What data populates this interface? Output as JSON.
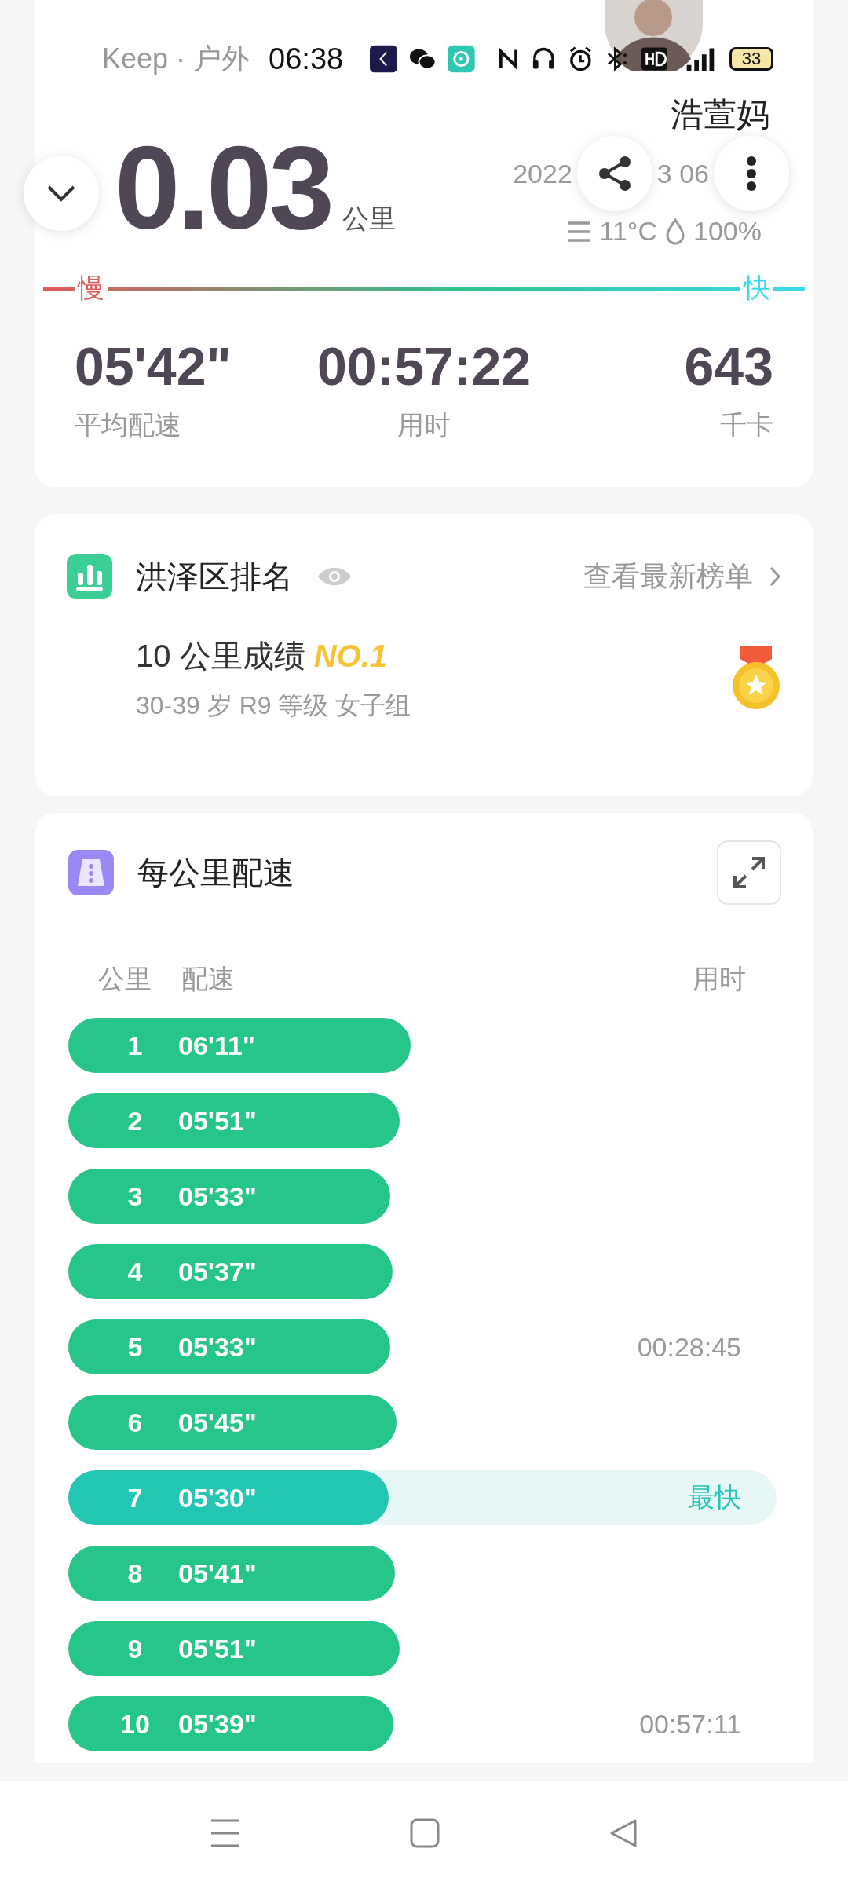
{
  "status_bar": {
    "time": "06:38",
    "battery": "33"
  },
  "header": {
    "app_title": "Keep · 户外",
    "user_name": "浩萱妈",
    "date_parts": [
      "2022",
      "3 06"
    ],
    "distance": "0.03",
    "distance_unit": "公里",
    "weather": "11°C",
    "humidity": "100%"
  },
  "pace_scale": {
    "slow_label": "慢",
    "fast_label": "快"
  },
  "stats": [
    {
      "value": "05'42\"",
      "label": "平均配速"
    },
    {
      "value": "00:57:22",
      "label": "用时"
    },
    {
      "value": "643",
      "label": "千卡"
    }
  ],
  "ranking": {
    "title": "洪泽区排名",
    "link": "查看最新榜单",
    "result": "10 公里成绩 *NO.1*",
    "subtitle": "30-39 岁 R9 等级 女子组"
  },
  "splits": {
    "title": "每公里配速",
    "columns": [
      "公里",
      "配速",
      "用时"
    ],
    "rows": [
      {
        "km": "1",
        "pace": "06'11\"",
        "fastest": false
      },
      {
        "km": "2",
        "pace": "05'51\"",
        "fastest": false
      },
      {
        "km": "3",
        "pace": "05'33\"",
        "fastest": false
      },
      {
        "km": "4",
        "pace": "05'37\"",
        "fastest": false
      },
      {
        "km": "5",
        "pace": "05'33\"",
        "fastest": false,
        "time": "00:28:45"
      },
      {
        "km": "6",
        "pace": "05'45\"",
        "fastest": false
      },
      {
        "km": "7",
        "pace": "05'30\"",
        "fastest": true,
        "tag": "最快"
      },
      {
        "km": "8",
        "pace": "05'41\"",
        "fastest": false
      },
      {
        "km": "9",
        "pace": "05'51\"",
        "fastest": false
      },
      {
        "km": "10",
        "pace": "05'39\"",
        "fastest": false,
        "time": "00:57:11"
      }
    ]
  }
}
